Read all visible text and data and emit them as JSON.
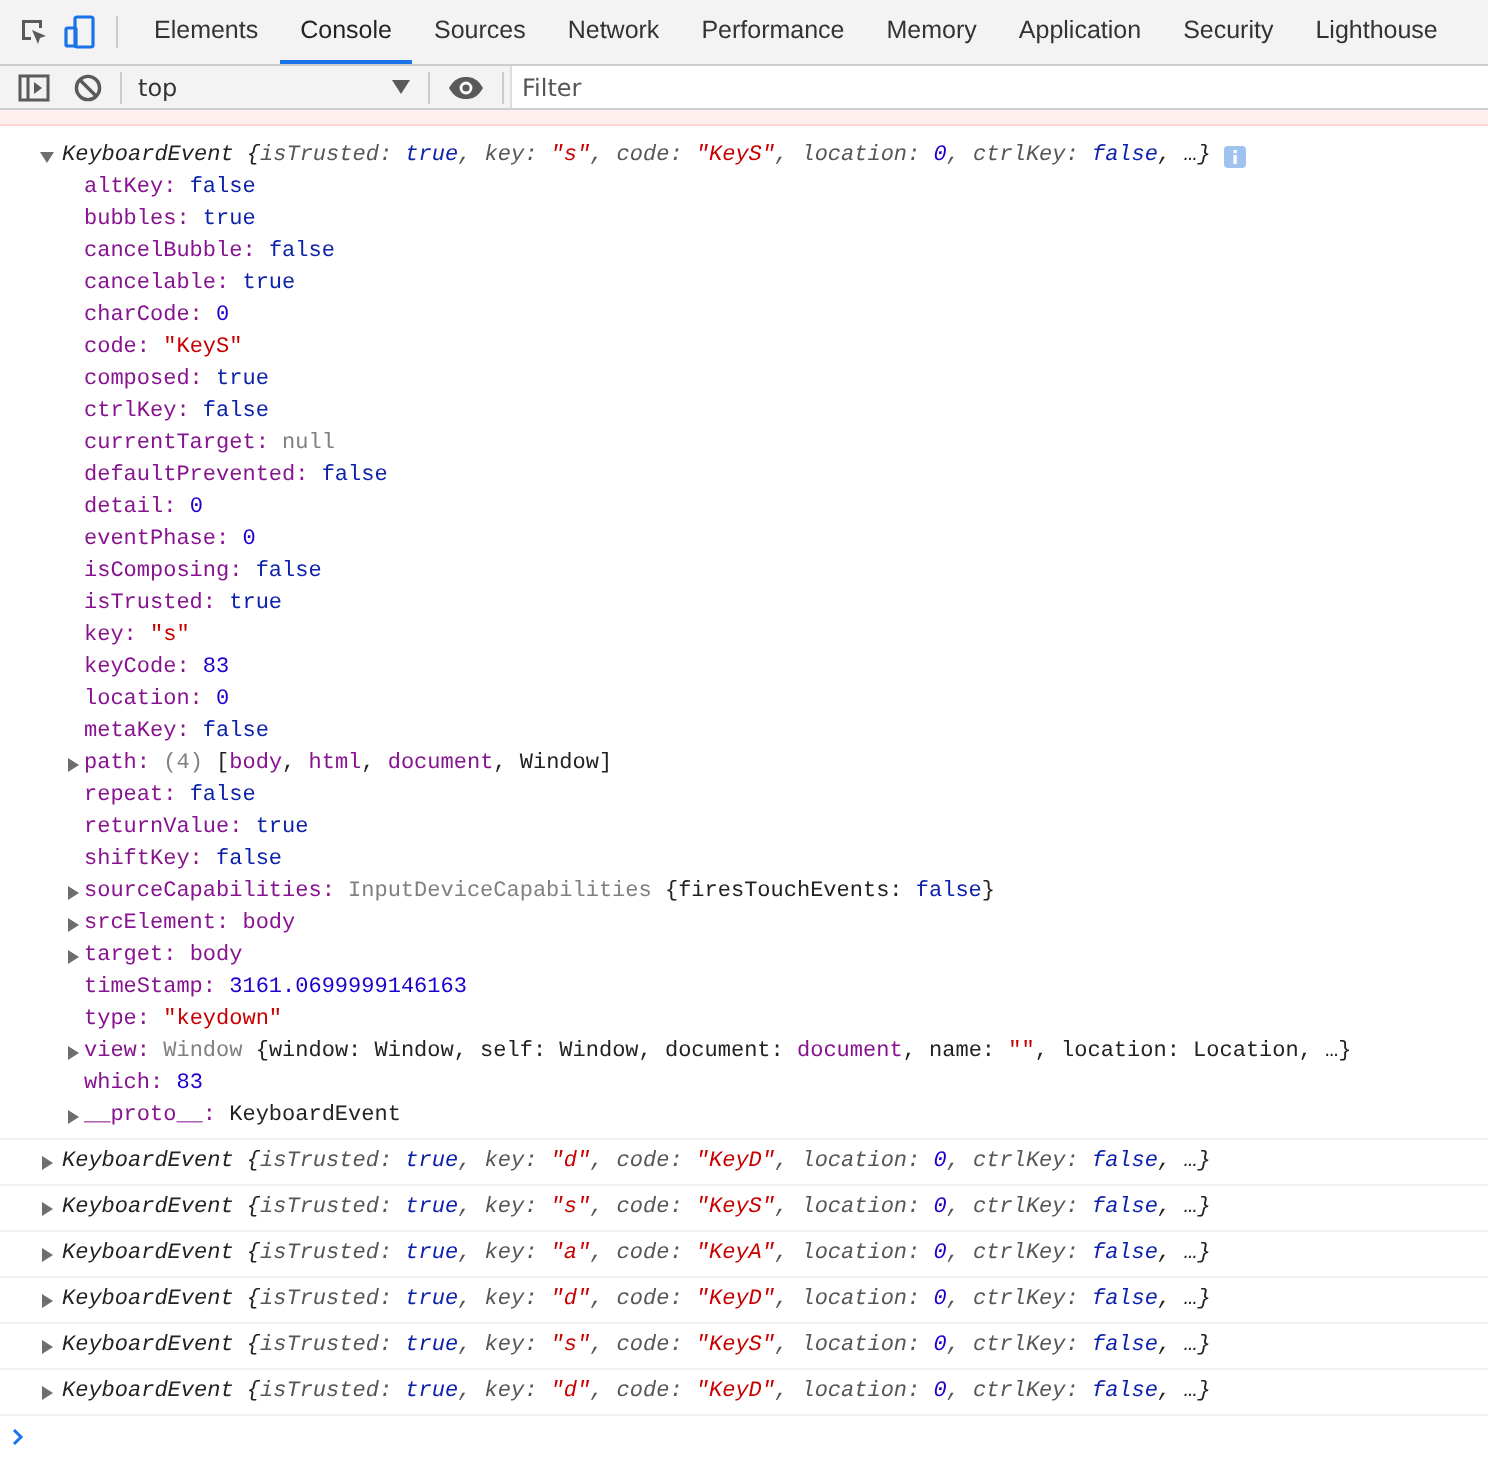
{
  "tabs": [
    {
      "label": "Elements",
      "selected": false
    },
    {
      "label": "Console",
      "selected": true
    },
    {
      "label": "Sources",
      "selected": false
    },
    {
      "label": "Network",
      "selected": false
    },
    {
      "label": "Performance",
      "selected": false
    },
    {
      "label": "Memory",
      "selected": false
    },
    {
      "label": "Application",
      "selected": false
    },
    {
      "label": "Security",
      "selected": false
    },
    {
      "label": "Lighthouse",
      "selected": false
    }
  ],
  "device_toolbar": {
    "on": true
  },
  "toolbar": {
    "context": "top",
    "filter": {
      "placeholder": "Filter"
    }
  },
  "log": [
    {
      "expanded": true,
      "summary": [
        {
          "kind": "text",
          "text": "KeyboardEvent {"
        },
        {
          "kind": "key",
          "text": "isTrusted: "
        },
        {
          "kind": "keyword",
          "text": "true"
        },
        {
          "kind": "key",
          "text": ", key: "
        },
        {
          "kind": "string",
          "text": "\"s\""
        },
        {
          "kind": "key",
          "text": ", code: "
        },
        {
          "kind": "string",
          "text": "\"KeyS\""
        },
        {
          "kind": "key",
          "text": ", location: "
        },
        {
          "kind": "number",
          "text": "0"
        },
        {
          "kind": "key",
          "text": ", ctrlKey: "
        },
        {
          "kind": "keyword",
          "text": "false"
        },
        {
          "kind": "text",
          "text": ", …}"
        }
      ],
      "properties": [
        {
          "name": "altKey:",
          "expandable": false,
          "value": [
            {
              "kind": "keyword",
              "text": "false"
            }
          ]
        },
        {
          "name": "bubbles:",
          "expandable": false,
          "value": [
            {
              "kind": "keyword",
              "text": "true"
            }
          ]
        },
        {
          "name": "cancelBubble:",
          "expandable": false,
          "value": [
            {
              "kind": "keyword",
              "text": "false"
            }
          ]
        },
        {
          "name": "cancelable:",
          "expandable": false,
          "value": [
            {
              "kind": "keyword",
              "text": "true"
            }
          ]
        },
        {
          "name": "charCode:",
          "expandable": false,
          "value": [
            {
              "kind": "number",
              "text": "0"
            }
          ]
        },
        {
          "name": "code:",
          "expandable": false,
          "value": [
            {
              "kind": "string",
              "text": "\"KeyS\""
            }
          ]
        },
        {
          "name": "composed:",
          "expandable": false,
          "value": [
            {
              "kind": "keyword",
              "text": "true"
            }
          ]
        },
        {
          "name": "ctrlKey:",
          "expandable": false,
          "value": [
            {
              "kind": "keyword",
              "text": "false"
            }
          ]
        },
        {
          "name": "currentTarget:",
          "expandable": false,
          "value": [
            {
              "kind": "null",
              "text": "null"
            }
          ]
        },
        {
          "name": "defaultPrevented:",
          "expandable": false,
          "value": [
            {
              "kind": "keyword",
              "text": "false"
            }
          ]
        },
        {
          "name": "detail:",
          "expandable": false,
          "value": [
            {
              "kind": "number",
              "text": "0"
            }
          ]
        },
        {
          "name": "eventPhase:",
          "expandable": false,
          "value": [
            {
              "kind": "number",
              "text": "0"
            }
          ]
        },
        {
          "name": "isComposing:",
          "expandable": false,
          "value": [
            {
              "kind": "keyword",
              "text": "false"
            }
          ]
        },
        {
          "name": "isTrusted:",
          "expandable": false,
          "value": [
            {
              "kind": "keyword",
              "text": "true"
            }
          ]
        },
        {
          "name": "key:",
          "expandable": false,
          "value": [
            {
              "kind": "string",
              "text": "\"s\""
            }
          ]
        },
        {
          "name": "keyCode:",
          "expandable": false,
          "value": [
            {
              "kind": "number",
              "text": "83"
            }
          ]
        },
        {
          "name": "location:",
          "expandable": false,
          "value": [
            {
              "kind": "number",
              "text": "0"
            }
          ]
        },
        {
          "name": "metaKey:",
          "expandable": false,
          "value": [
            {
              "kind": "keyword",
              "text": "false"
            }
          ]
        },
        {
          "name": "path:",
          "expandable": true,
          "value": [
            {
              "kind": "null",
              "text": "(4) "
            },
            {
              "kind": "text",
              "text": "["
            },
            {
              "kind": "name",
              "text": "body"
            },
            {
              "kind": "text",
              "text": ", "
            },
            {
              "kind": "name",
              "text": "html"
            },
            {
              "kind": "text",
              "text": ", "
            },
            {
              "kind": "name",
              "text": "document"
            },
            {
              "kind": "text",
              "text": ", Window]"
            }
          ]
        },
        {
          "name": "repeat:",
          "expandable": false,
          "value": [
            {
              "kind": "keyword",
              "text": "false"
            }
          ]
        },
        {
          "name": "returnValue:",
          "expandable": false,
          "value": [
            {
              "kind": "keyword",
              "text": "true"
            }
          ]
        },
        {
          "name": "shiftKey:",
          "expandable": false,
          "value": [
            {
              "kind": "keyword",
              "text": "false"
            }
          ]
        },
        {
          "name": "sourceCapabilities:",
          "expandable": true,
          "value": [
            {
              "kind": "null",
              "text": "InputDeviceCapabilities "
            },
            {
              "kind": "text",
              "text": "{firesTouchEvents: "
            },
            {
              "kind": "keyword",
              "text": "false"
            },
            {
              "kind": "text",
              "text": "}"
            }
          ]
        },
        {
          "name": "srcElement:",
          "expandable": true,
          "value": [
            {
              "kind": "name",
              "text": "body"
            }
          ]
        },
        {
          "name": "target:",
          "expandable": true,
          "value": [
            {
              "kind": "name",
              "text": "body"
            }
          ]
        },
        {
          "name": "timeStamp:",
          "expandable": false,
          "value": [
            {
              "kind": "number",
              "text": "3161.0699999146163"
            }
          ]
        },
        {
          "name": "type:",
          "expandable": false,
          "value": [
            {
              "kind": "string",
              "text": "\"keydown\""
            }
          ]
        },
        {
          "name": "view:",
          "expandable": true,
          "value": [
            {
              "kind": "null",
              "text": "Window "
            },
            {
              "kind": "text",
              "text": "{window: Window, self: Window, document: "
            },
            {
              "kind": "name",
              "text": "document"
            },
            {
              "kind": "text",
              "text": ", name: "
            },
            {
              "kind": "string",
              "text": "\"\""
            },
            {
              "kind": "text",
              "text": ", location: Location, …}"
            }
          ]
        },
        {
          "name": "which:",
          "expandable": false,
          "value": [
            {
              "kind": "number",
              "text": "83"
            }
          ]
        },
        {
          "name": "__proto__:",
          "expandable": true,
          "value": [
            {
              "kind": "text",
              "text": "KeyboardEvent"
            }
          ]
        }
      ]
    },
    {
      "expanded": false,
      "summary": [
        {
          "kind": "text",
          "text": "KeyboardEvent {"
        },
        {
          "kind": "key",
          "text": "isTrusted: "
        },
        {
          "kind": "keyword",
          "text": "true"
        },
        {
          "kind": "key",
          "text": ", key: "
        },
        {
          "kind": "string",
          "text": "\"d\""
        },
        {
          "kind": "key",
          "text": ", code: "
        },
        {
          "kind": "string",
          "text": "\"KeyD\""
        },
        {
          "kind": "key",
          "text": ", location: "
        },
        {
          "kind": "number",
          "text": "0"
        },
        {
          "kind": "key",
          "text": ", ctrlKey: "
        },
        {
          "kind": "keyword",
          "text": "false"
        },
        {
          "kind": "text",
          "text": ", …}"
        }
      ]
    },
    {
      "expanded": false,
      "summary": [
        {
          "kind": "text",
          "text": "KeyboardEvent {"
        },
        {
          "kind": "key",
          "text": "isTrusted: "
        },
        {
          "kind": "keyword",
          "text": "true"
        },
        {
          "kind": "key",
          "text": ", key: "
        },
        {
          "kind": "string",
          "text": "\"s\""
        },
        {
          "kind": "key",
          "text": ", code: "
        },
        {
          "kind": "string",
          "text": "\"KeyS\""
        },
        {
          "kind": "key",
          "text": ", location: "
        },
        {
          "kind": "number",
          "text": "0"
        },
        {
          "kind": "key",
          "text": ", ctrlKey: "
        },
        {
          "kind": "keyword",
          "text": "false"
        },
        {
          "kind": "text",
          "text": ", …}"
        }
      ]
    },
    {
      "expanded": false,
      "summary": [
        {
          "kind": "text",
          "text": "KeyboardEvent {"
        },
        {
          "kind": "key",
          "text": "isTrusted: "
        },
        {
          "kind": "keyword",
          "text": "true"
        },
        {
          "kind": "key",
          "text": ", key: "
        },
        {
          "kind": "string",
          "text": "\"a\""
        },
        {
          "kind": "key",
          "text": ", code: "
        },
        {
          "kind": "string",
          "text": "\"KeyA\""
        },
        {
          "kind": "key",
          "text": ", location: "
        },
        {
          "kind": "number",
          "text": "0"
        },
        {
          "kind": "key",
          "text": ", ctrlKey: "
        },
        {
          "kind": "keyword",
          "text": "false"
        },
        {
          "kind": "text",
          "text": ", …}"
        }
      ]
    },
    {
      "expanded": false,
      "summary": [
        {
          "kind": "text",
          "text": "KeyboardEvent {"
        },
        {
          "kind": "key",
          "text": "isTrusted: "
        },
        {
          "kind": "keyword",
          "text": "true"
        },
        {
          "kind": "key",
          "text": ", key: "
        },
        {
          "kind": "string",
          "text": "\"d\""
        },
        {
          "kind": "key",
          "text": ", code: "
        },
        {
          "kind": "string",
          "text": "\"KeyD\""
        },
        {
          "kind": "key",
          "text": ", location: "
        },
        {
          "kind": "number",
          "text": "0"
        },
        {
          "kind": "key",
          "text": ", ctrlKey: "
        },
        {
          "kind": "keyword",
          "text": "false"
        },
        {
          "kind": "text",
          "text": ", …}"
        }
      ]
    },
    {
      "expanded": false,
      "summary": [
        {
          "kind": "text",
          "text": "KeyboardEvent {"
        },
        {
          "kind": "key",
          "text": "isTrusted: "
        },
        {
          "kind": "keyword",
          "text": "true"
        },
        {
          "kind": "key",
          "text": ", key: "
        },
        {
          "kind": "string",
          "text": "\"s\""
        },
        {
          "kind": "key",
          "text": ", code: "
        },
        {
          "kind": "string",
          "text": "\"KeyS\""
        },
        {
          "kind": "key",
          "text": ", location: "
        },
        {
          "kind": "number",
          "text": "0"
        },
        {
          "kind": "key",
          "text": ", ctrlKey: "
        },
        {
          "kind": "keyword",
          "text": "false"
        },
        {
          "kind": "text",
          "text": ", …}"
        }
      ]
    },
    {
      "expanded": false,
      "summary": [
        {
          "kind": "text",
          "text": "KeyboardEvent {"
        },
        {
          "kind": "key",
          "text": "isTrusted: "
        },
        {
          "kind": "keyword",
          "text": "true"
        },
        {
          "kind": "key",
          "text": ", key: "
        },
        {
          "kind": "string",
          "text": "\"d\""
        },
        {
          "kind": "key",
          "text": ", code: "
        },
        {
          "kind": "string",
          "text": "\"KeyD\""
        },
        {
          "kind": "key",
          "text": ", location: "
        },
        {
          "kind": "number",
          "text": "0"
        },
        {
          "kind": "key",
          "text": ", ctrlKey: "
        },
        {
          "kind": "keyword",
          "text": "false"
        },
        {
          "kind": "text",
          "text": ", …}"
        }
      ]
    }
  ]
}
